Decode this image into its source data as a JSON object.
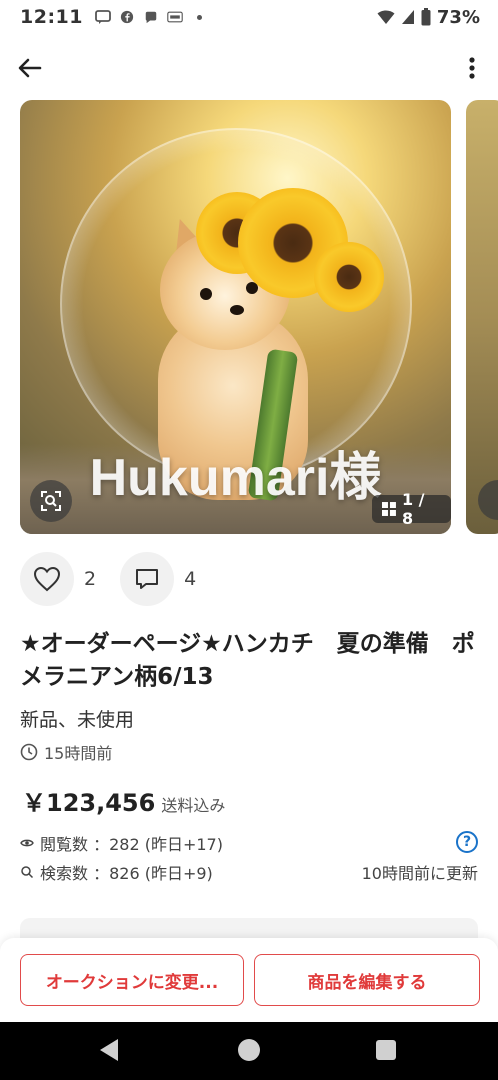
{
  "status_bar": {
    "time": "12:11",
    "battery": "73%"
  },
  "listing": {
    "watermark": "Hukumari様",
    "image_counter": "1 / 8",
    "likes": "2",
    "comments": "4",
    "title": "★オーダーページ★ハンカチ　夏の準備　ポメラニアン柄6/13",
    "condition": "新品、未使用",
    "posted_time": "15時間前",
    "price": "￥123,456",
    "shipping": "送料込み",
    "views": "閲覧数 ：282 (昨日+17)",
    "searches": "検索数 ：826 (昨日+9)",
    "updated": "10時間前に更新"
  },
  "buttons": {
    "auction": "オークションに変更...",
    "edit": "商品を編集する"
  },
  "colors": {
    "accent_red": "#e03a3a",
    "help_blue": "#1a73c9"
  }
}
